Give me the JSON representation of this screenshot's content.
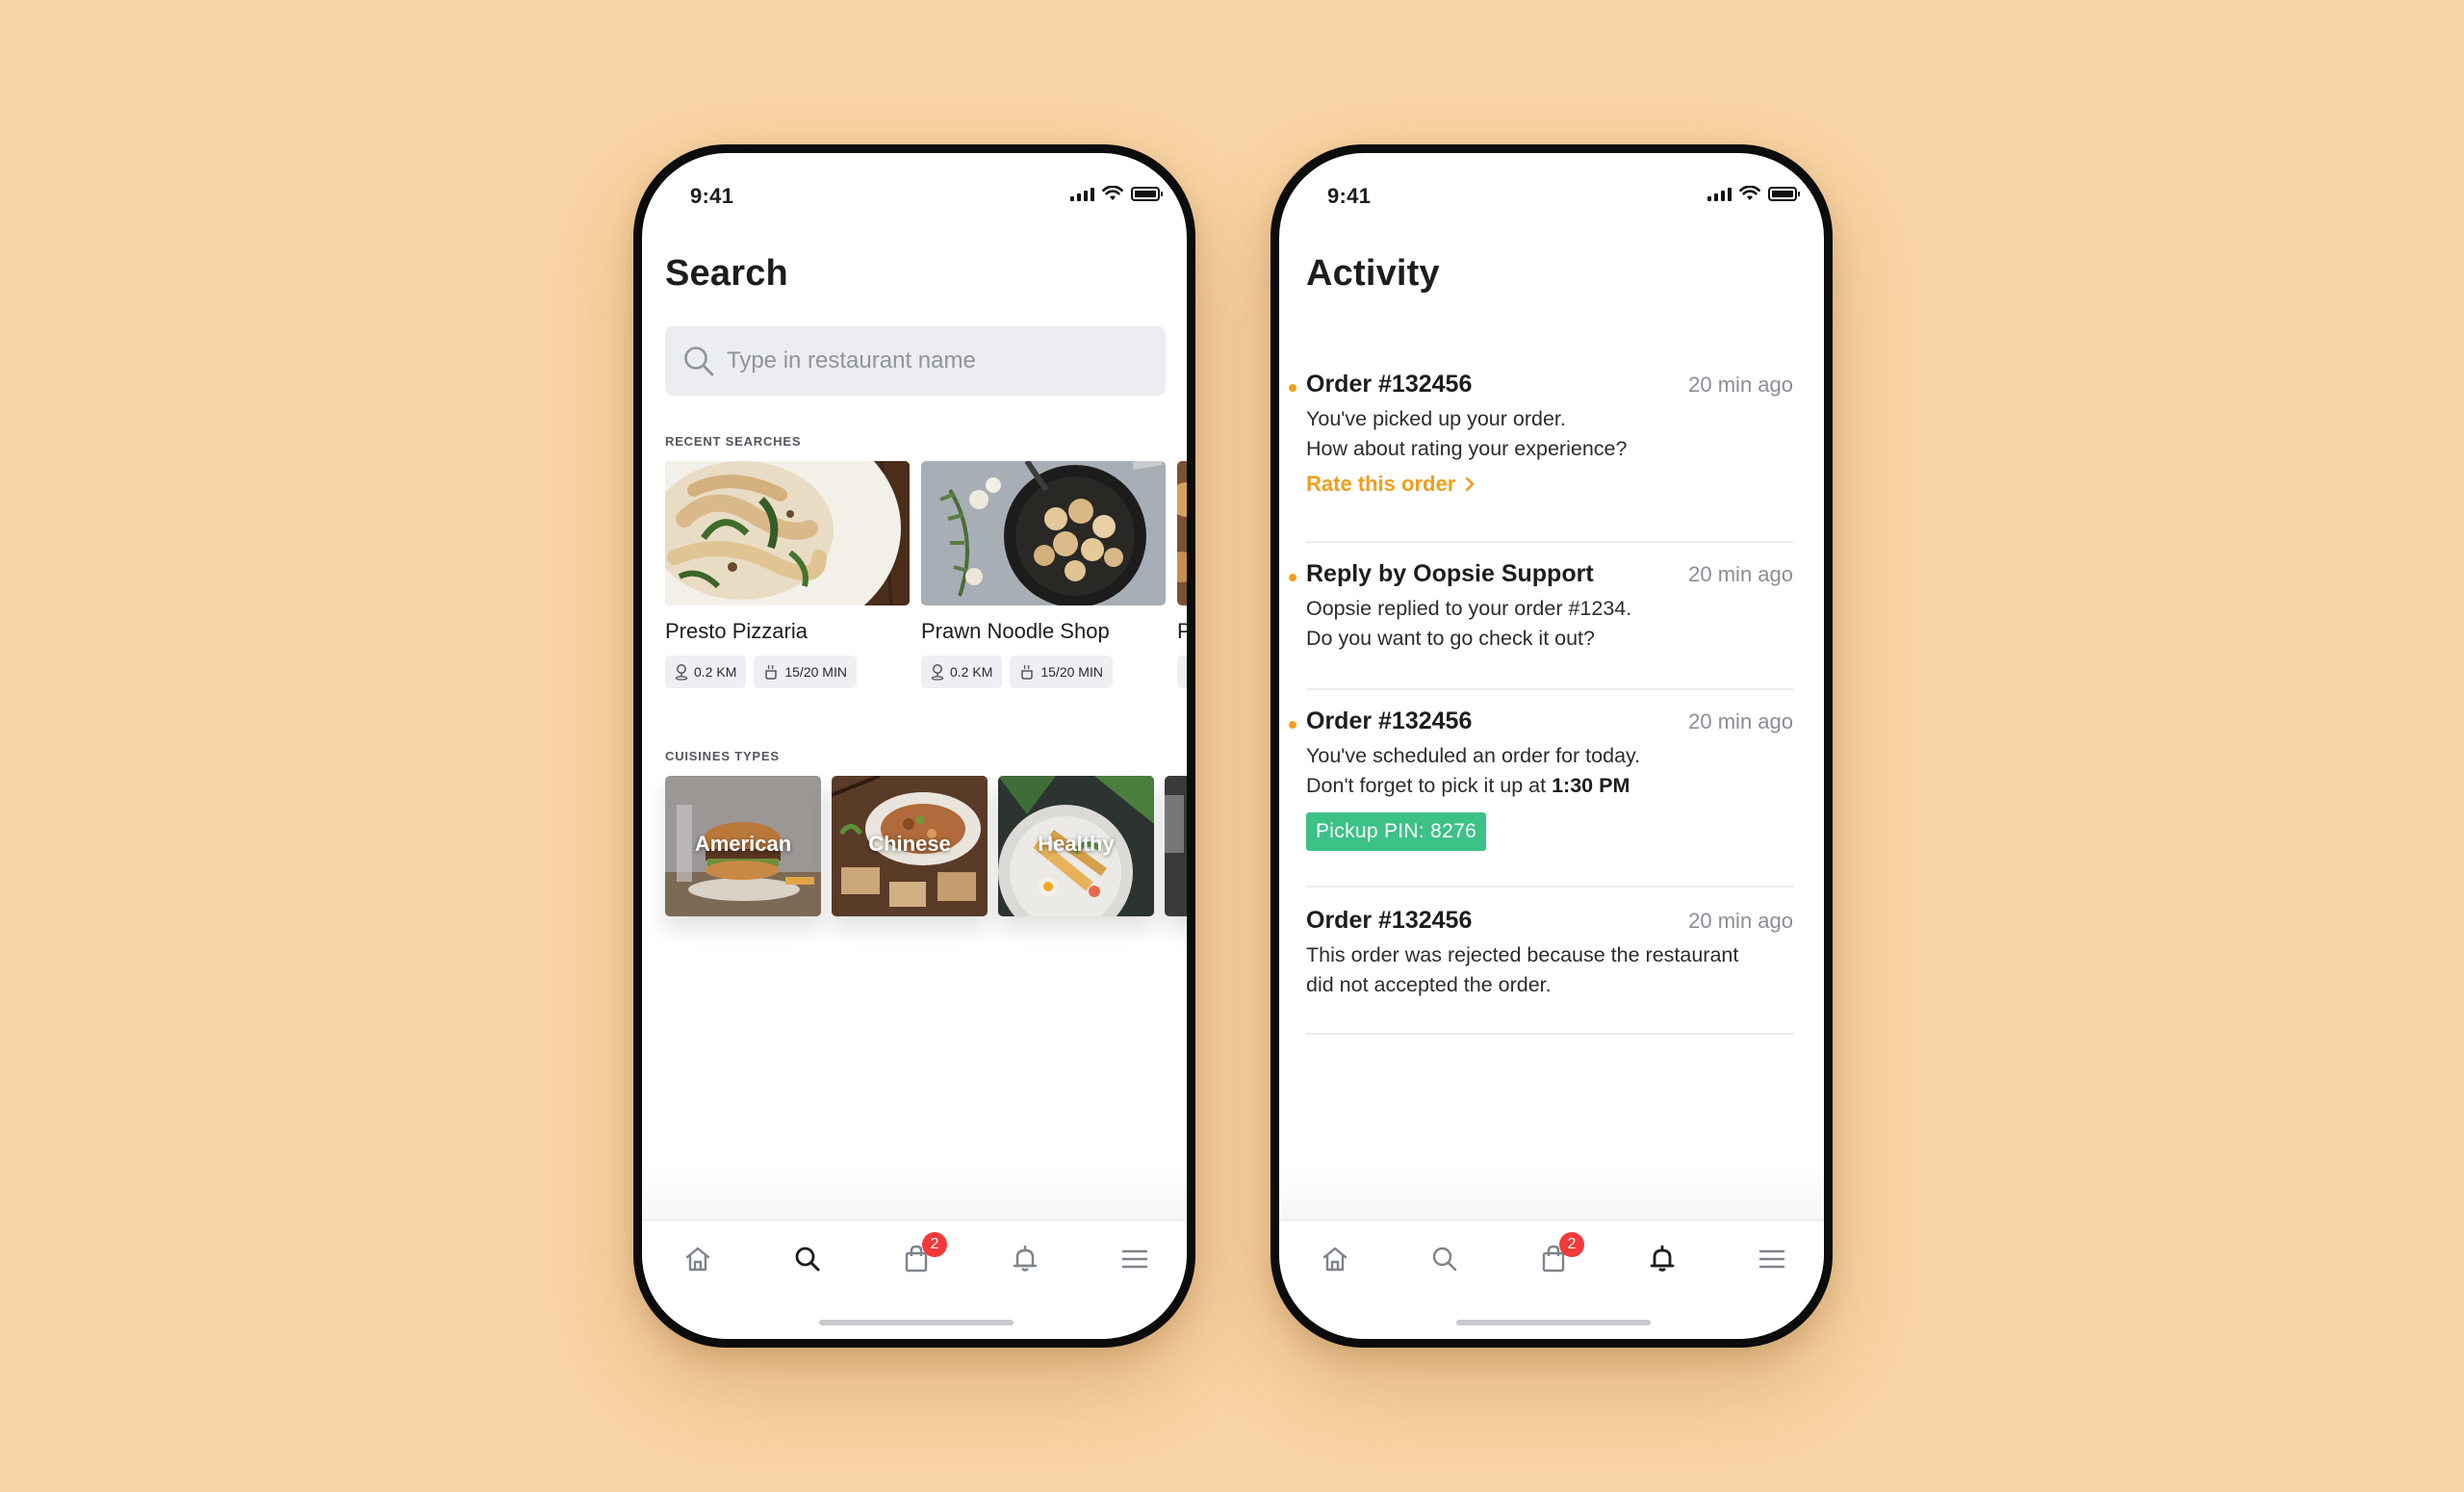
{
  "status_bar": {
    "time": "9:41"
  },
  "search_screen": {
    "title": "Search",
    "search_placeholder": "Type in restaurant name",
    "recent_label": "RECENT SEARCHES",
    "recent": [
      {
        "name": "Presto Pizzaria",
        "distance": "0.2 KM",
        "time": "15/20 MIN"
      },
      {
        "name": "Prawn Noodle Shop",
        "distance": "0.2 KM",
        "time": "15/20 MIN"
      },
      {
        "name": "P"
      }
    ],
    "cuisines_label": "CUISINES TYPES",
    "cuisines": [
      "American",
      "Chinese",
      "Healthy"
    ]
  },
  "activity_screen": {
    "title": "Activity",
    "items": [
      {
        "title": "Order #132456",
        "time": "20 min ago",
        "line1": "You've picked up your order.",
        "line2": "How about rating your experience?",
        "link": "Rate this order"
      },
      {
        "title": "Reply by Oopsie Support",
        "time": "20 min ago",
        "line1": "Oopsie replied to your order #1234.",
        "line2": "Do you want to go check it out?"
      },
      {
        "title": "Order #132456",
        "time": "20 min ago",
        "line1": "You've scheduled an order for today.",
        "line2_prefix": "Don't forget to pick it up at",
        "line2_bold": "1:30 PM",
        "pin": "Pickup PIN: 8276"
      },
      {
        "title": "Order #132456",
        "time": "20 min ago",
        "line1": "This order was rejected because the restaurant",
        "line2": "did not accepted the order."
      }
    ]
  },
  "tab_bar": {
    "cart_badge": "2"
  },
  "colors": {
    "background": "#f9d4a4",
    "accent_orange": "#f29e1b",
    "pin_green": "#3cc187",
    "badge_red": "#f23a3a"
  }
}
